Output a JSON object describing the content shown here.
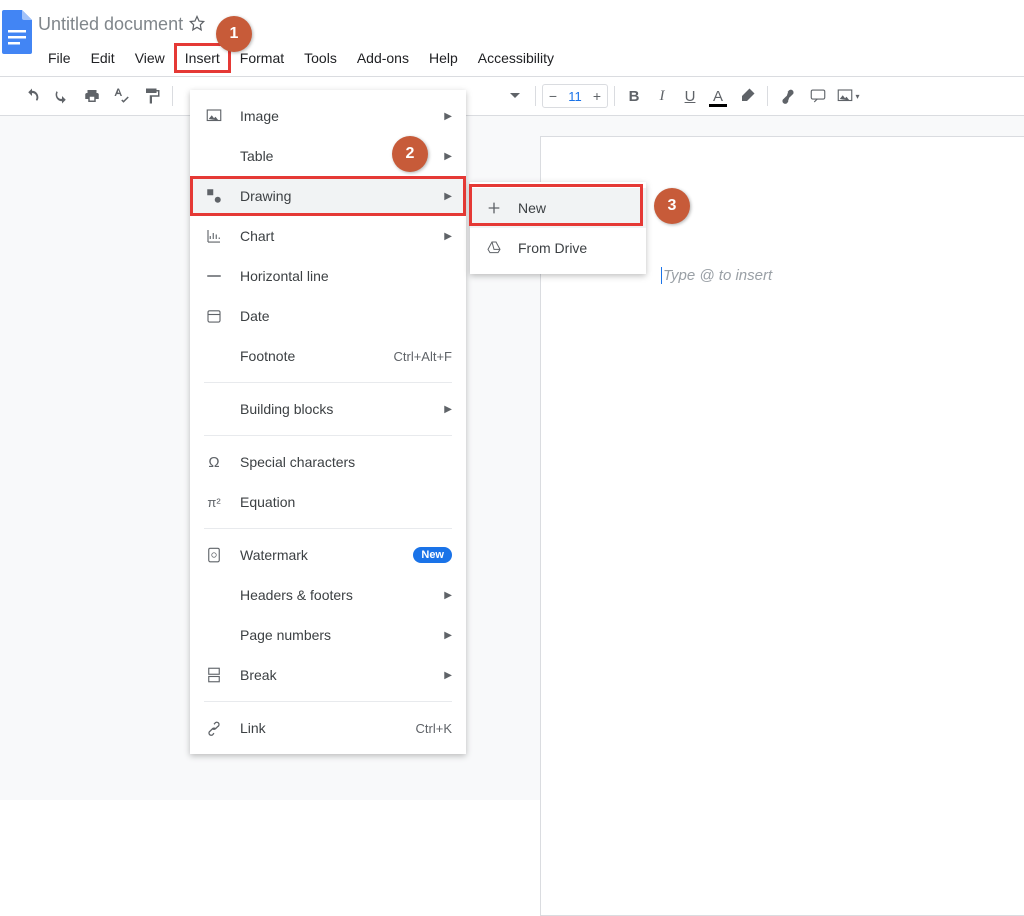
{
  "doc": {
    "title": "Untitled document",
    "placeholder": "Type @ to insert",
    "fontSize": "11"
  },
  "menu": {
    "file": "File",
    "edit": "Edit",
    "view": "View",
    "insert": "Insert",
    "format": "Format",
    "tools": "Tools",
    "addons": "Add-ons",
    "help": "Help",
    "accessibility": "Accessibility"
  },
  "insertMenu": {
    "image": "Image",
    "table": "Table",
    "drawing": "Drawing",
    "chart": "Chart",
    "hline": "Horizontal line",
    "date": "Date",
    "footnote": "Footnote",
    "footnoteShortcut": "Ctrl+Alt+F",
    "blocks": "Building blocks",
    "special": "Special characters",
    "equation": "Equation",
    "watermark": "Watermark",
    "newBadge": "New",
    "headers": "Headers & footers",
    "pageNums": "Page numbers",
    "break": "Break",
    "link": "Link",
    "linkShortcut": "Ctrl+K"
  },
  "drawingSub": {
    "new": "New",
    "fromDrive": "From Drive"
  },
  "steps": {
    "s1": "1",
    "s2": "2",
    "s3": "3"
  }
}
